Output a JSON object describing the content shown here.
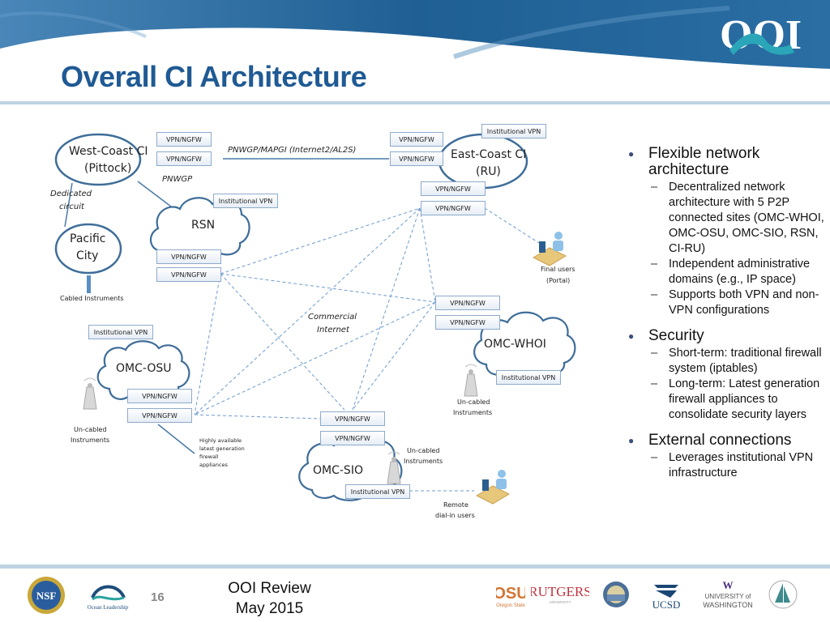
{
  "slide": {
    "title": "Overall CI Architecture",
    "logo": "OOI",
    "page_number": "16",
    "footer_line1": "OOI Review",
    "footer_line2": "May 2015"
  },
  "diagram": {
    "nodes": {
      "west_coast": {
        "line1": "West-Coast CI",
        "line2": "(Pittock)"
      },
      "east_coast": {
        "line1": "East-Coast CI",
        "line2": "(RU)"
      },
      "pacific_city": {
        "line1": "Pacific",
        "line2": "City"
      },
      "rsn": "RSN",
      "omc_osu": "OMC-OSU",
      "omc_whoi": "OMC-WHOI",
      "omc_sio": "OMC-SIO"
    },
    "boxes": {
      "vpn_ngfw": "VPN/NGFW",
      "institutional_vpn": "Institutional VPN"
    },
    "labels": {
      "pnwgp_mapgi": "PNWGP/MAPGI (Internet2/AL2S)",
      "pnwgp": "PNWGP",
      "dedicated_circuit_1": "Dedicated",
      "dedicated_circuit_2": "circuit",
      "cabled_instruments": "Cabled Instruments",
      "commercial_internet_1": "Commercial",
      "commercial_internet_2": "Internet",
      "uncabled_1": "Un-cabled",
      "uncabled_2": "Instruments",
      "final_users_1": "Final users",
      "final_users_2": "(Portal)",
      "remote_users_1": "Remote",
      "remote_users_2": "dial-in users",
      "firewall_note_1": "Highly available",
      "firewall_note_2": "latest generation",
      "firewall_note_3": "firewall",
      "firewall_note_4": "appliances"
    }
  },
  "bullets": [
    {
      "text": "Flexible network architecture",
      "sub": [
        "Decentralized network architecture with 5 P2P connected sites (OMC-WHOI, OMC-OSU, OMC-SIO, RSN, CI-RU)",
        "Independent administrative domains (e.g., IP space)",
        "Supports both VPN and non-VPN configurations"
      ]
    },
    {
      "text": "Security",
      "sub": [
        "Short-term: traditional firewall system (iptables)",
        "Long-term: Latest generation firewall appliances to consolidate security layers"
      ]
    },
    {
      "text": "External connections",
      "sub": [
        "Leverages institutional VPN infrastructure"
      ]
    }
  ],
  "footer_logos": [
    "NSF",
    "Ocean Leadership",
    "OSU Oregon State",
    "RUTGERS",
    "seal",
    "UCSD",
    "UNIVERSITY of WASHINGTON",
    "WHOI"
  ],
  "colors": {
    "title": "#1f5a94",
    "header_blue": "#1f5f93",
    "node_stroke": "#3e6d99",
    "dashed_link": "#6d9bcc",
    "box_border": "#8eaacb"
  }
}
